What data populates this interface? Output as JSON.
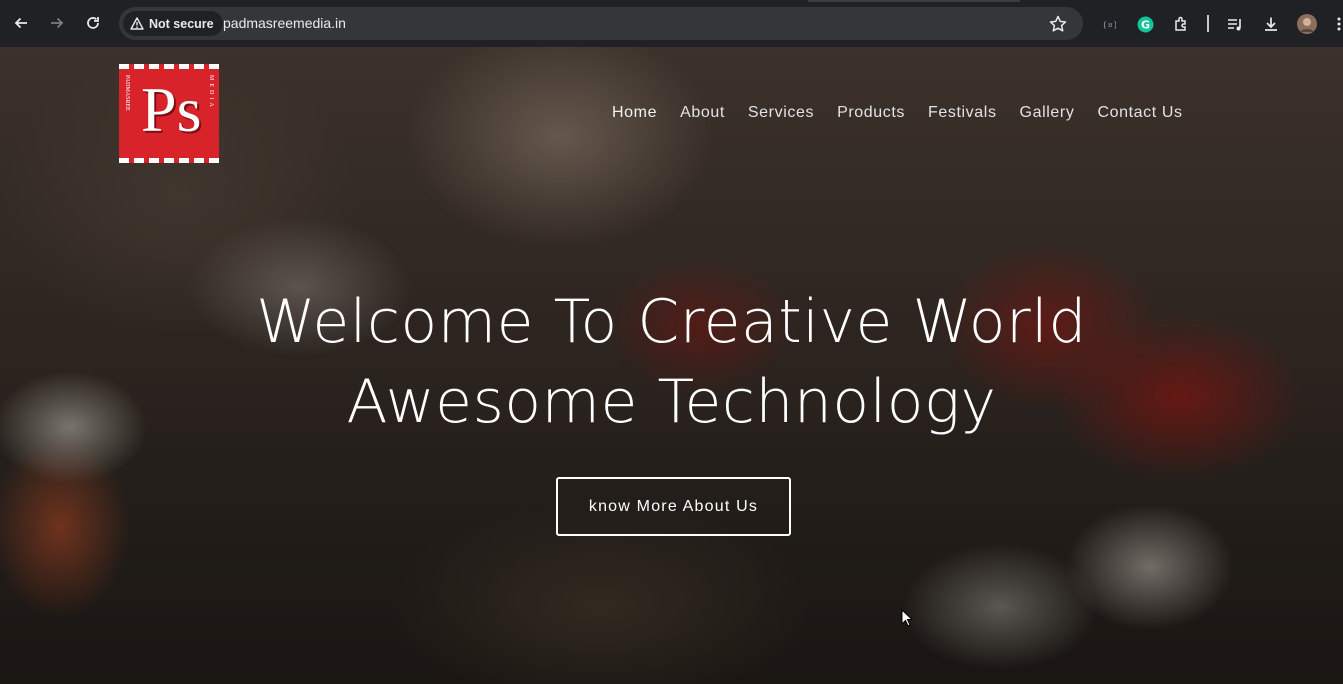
{
  "browser": {
    "security_label": "Not secure",
    "url": "padmasreemedia.in"
  },
  "site": {
    "logo": {
      "monogram": "Ps",
      "left_text": "PADMASREE",
      "right_text": "MEDIA",
      "color": "#d9232b"
    },
    "nav": [
      {
        "label": "Home"
      },
      {
        "label": "About"
      },
      {
        "label": "Services"
      },
      {
        "label": "Products"
      },
      {
        "label": "Festivals"
      },
      {
        "label": "Gallery"
      },
      {
        "label": "Contact Us"
      }
    ],
    "hero": {
      "headline_line1": "Welcome To Creative World",
      "headline_line2": "Awesome Technology",
      "cta_label": "know More About Us"
    }
  },
  "icons": [
    "back-arrow-icon",
    "forward-arrow-icon",
    "reload-icon",
    "warning-icon",
    "bookmark-star-icon",
    "cast-icon",
    "grammarly-icon",
    "extensions-icon",
    "media-controls-icon",
    "download-icon",
    "profile-avatar-icon",
    "more-menu-icon",
    "mouse-cursor-icon"
  ]
}
